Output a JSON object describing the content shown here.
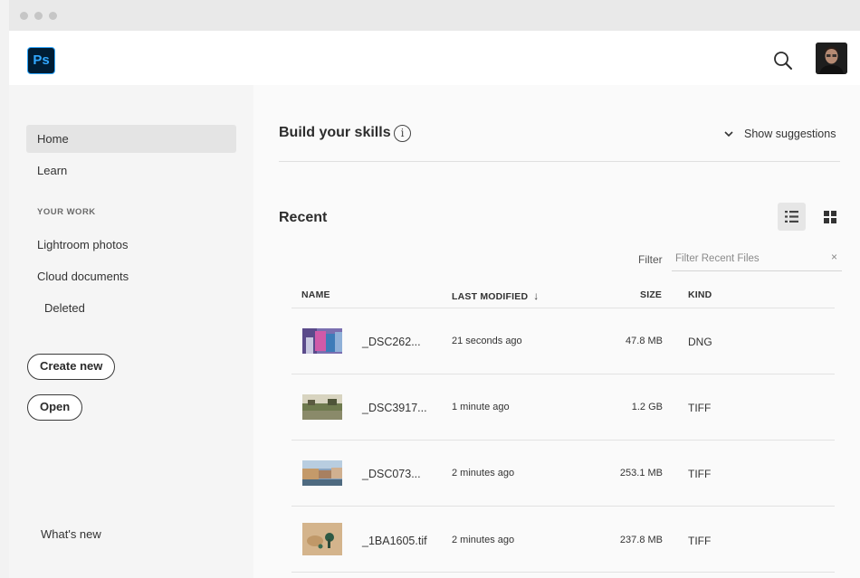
{
  "app": {
    "logo_text": "Ps",
    "accent": "#31a8ff",
    "logo_bg": "#001d34"
  },
  "sidebar": {
    "items": [
      {
        "label": "Home",
        "active": true
      },
      {
        "label": "Learn",
        "active": false
      }
    ],
    "your_work_heading": "YOUR WORK",
    "your_work_items": [
      {
        "label": "Lightroom photos"
      },
      {
        "label": "Cloud documents"
      },
      {
        "label": "Deleted"
      }
    ],
    "create_new_label": "Create new",
    "open_label": "Open",
    "whats_new_label": "What's new"
  },
  "skills": {
    "title": "Build your skills",
    "info_icon": "i",
    "show_suggestions_label": "Show suggestions"
  },
  "recent": {
    "title": "Recent",
    "filter_label": "Filter",
    "filter_placeholder": "Filter Recent Files",
    "filter_clear": "×",
    "view_modes": [
      "list-view-icon",
      "grid-view-icon"
    ],
    "columns": {
      "name": "NAME",
      "last_modified": "LAST MODIFIED",
      "size": "SIZE",
      "kind": "KIND"
    },
    "sort_indicator": "↓",
    "files": [
      {
        "name": "_DSC262...",
        "modified": "21 seconds ago",
        "size": "47.8 MB",
        "kind": "DNG"
      },
      {
        "name": "_DSC3917...",
        "modified": "1 minute ago",
        "size": "1.2 GB",
        "kind": "TIFF"
      },
      {
        "name": "_DSC073...",
        "modified": "2 minutes ago",
        "size": "253.1 MB",
        "kind": "TIFF"
      },
      {
        "name": "_1BA1605.tif",
        "modified": "2 minutes ago",
        "size": "237.8 MB",
        "kind": "TIFF"
      }
    ]
  }
}
